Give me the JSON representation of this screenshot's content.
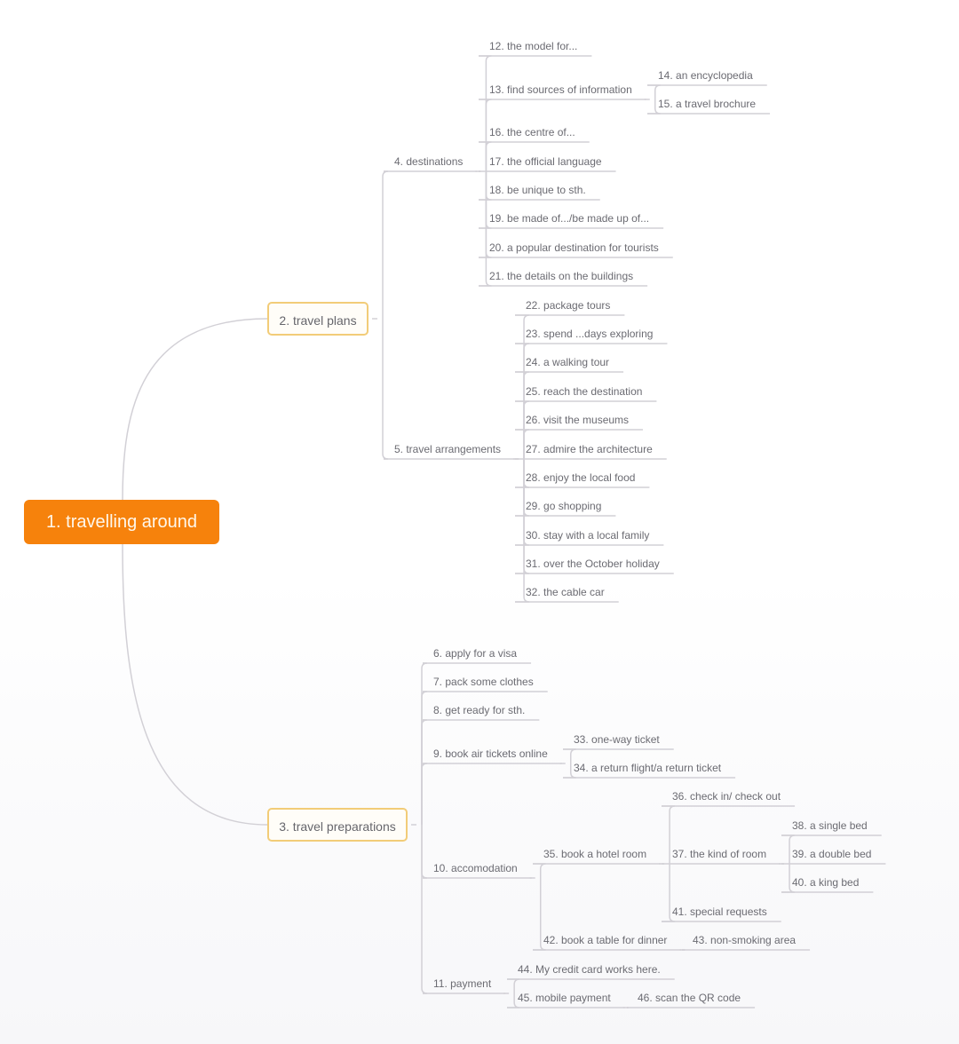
{
  "root": {
    "id": "n1",
    "label": "1. travelling around"
  },
  "nodes": [
    {
      "id": "n2",
      "label": "2. travel plans",
      "level": "main"
    },
    {
      "id": "n3",
      "label": "3. travel preparations",
      "level": "main"
    },
    {
      "id": "n4",
      "label": "4. destinations"
    },
    {
      "id": "n5",
      "label": "5. travel arrangements"
    },
    {
      "id": "n6",
      "label": "6. apply for a visa"
    },
    {
      "id": "n7",
      "label": "7. pack some clothes"
    },
    {
      "id": "n8",
      "label": "8. get ready for sth."
    },
    {
      "id": "n9",
      "label": "9. book air tickets online"
    },
    {
      "id": "n10",
      "label": "10. accomodation"
    },
    {
      "id": "n11",
      "label": "11. payment"
    },
    {
      "id": "n12",
      "label": "12. the model for..."
    },
    {
      "id": "n13",
      "label": "13. find sources of information"
    },
    {
      "id": "n14",
      "label": "14. an encyclopedia"
    },
    {
      "id": "n15",
      "label": "15. a travel brochure"
    },
    {
      "id": "n16",
      "label": "16. the centre of..."
    },
    {
      "id": "n17",
      "label": "17. the official language"
    },
    {
      "id": "n18",
      "label": "18. be unique to sth."
    },
    {
      "id": "n19",
      "label": "19. be made of.../be made up of..."
    },
    {
      "id": "n20",
      "label": "20. a popular destination for tourists"
    },
    {
      "id": "n21",
      "label": "21. the details on the buildings"
    },
    {
      "id": "n22",
      "label": "22. package tours"
    },
    {
      "id": "n23",
      "label": "23. spend ...days exploring"
    },
    {
      "id": "n24",
      "label": "24. a walking tour"
    },
    {
      "id": "n25",
      "label": "25. reach the destination"
    },
    {
      "id": "n26",
      "label": "26. visit the museums"
    },
    {
      "id": "n27",
      "label": "27. admire the architecture"
    },
    {
      "id": "n28",
      "label": "28. enjoy the local food"
    },
    {
      "id": "n29",
      "label": "29. go shopping"
    },
    {
      "id": "n30",
      "label": "30. stay with a local family"
    },
    {
      "id": "n31",
      "label": "31. over the October holiday"
    },
    {
      "id": "n32",
      "label": "32. the cable car"
    },
    {
      "id": "n33",
      "label": "33. one-way ticket"
    },
    {
      "id": "n34",
      "label": "34. a return flight/a return ticket"
    },
    {
      "id": "n35",
      "label": "35. book a hotel room"
    },
    {
      "id": "n36",
      "label": "36. check in/ check out"
    },
    {
      "id": "n37",
      "label": "37. the kind of room"
    },
    {
      "id": "n38",
      "label": "38. a single bed"
    },
    {
      "id": "n39",
      "label": "39. a double bed"
    },
    {
      "id": "n40",
      "label": "40. a king bed"
    },
    {
      "id": "n41",
      "label": "41. special requests"
    },
    {
      "id": "n42",
      "label": "42. book a table for dinner"
    },
    {
      "id": "n43",
      "label": "43. non-smoking area"
    },
    {
      "id": "n44",
      "label": "44. My credit card works here."
    },
    {
      "id": "n45",
      "label": "45. mobile payment"
    },
    {
      "id": "n46",
      "label": "46. scan the QR code"
    }
  ],
  "edges": [
    [
      "n1",
      "n2"
    ],
    [
      "n1",
      "n3"
    ],
    [
      "n2",
      "n4"
    ],
    [
      "n2",
      "n5"
    ],
    [
      "n3",
      "n6"
    ],
    [
      "n3",
      "n7"
    ],
    [
      "n3",
      "n8"
    ],
    [
      "n3",
      "n9"
    ],
    [
      "n3",
      "n10"
    ],
    [
      "n3",
      "n11"
    ],
    [
      "n4",
      "n12"
    ],
    [
      "n4",
      "n13"
    ],
    [
      "n4",
      "n16"
    ],
    [
      "n4",
      "n17"
    ],
    [
      "n4",
      "n18"
    ],
    [
      "n4",
      "n19"
    ],
    [
      "n4",
      "n20"
    ],
    [
      "n4",
      "n21"
    ],
    [
      "n13",
      "n14"
    ],
    [
      "n13",
      "n15"
    ],
    [
      "n5",
      "n22"
    ],
    [
      "n5",
      "n23"
    ],
    [
      "n5",
      "n24"
    ],
    [
      "n5",
      "n25"
    ],
    [
      "n5",
      "n26"
    ],
    [
      "n5",
      "n27"
    ],
    [
      "n5",
      "n28"
    ],
    [
      "n5",
      "n29"
    ],
    [
      "n5",
      "n30"
    ],
    [
      "n5",
      "n31"
    ],
    [
      "n5",
      "n32"
    ],
    [
      "n9",
      "n33"
    ],
    [
      "n9",
      "n34"
    ],
    [
      "n10",
      "n35"
    ],
    [
      "n10",
      "n42"
    ],
    [
      "n35",
      "n36"
    ],
    [
      "n35",
      "n37"
    ],
    [
      "n35",
      "n41"
    ],
    [
      "n37",
      "n38"
    ],
    [
      "n37",
      "n39"
    ],
    [
      "n37",
      "n40"
    ],
    [
      "n42",
      "n43"
    ],
    [
      "n11",
      "n44"
    ],
    [
      "n11",
      "n45"
    ],
    [
      "n45",
      "n46"
    ]
  ],
  "colors": {
    "root_fill": "#f6820c",
    "root_text": "#fff7ea",
    "main_border": "#f2cc78",
    "line": "#d2d0d6",
    "text": "#6b6b72"
  }
}
